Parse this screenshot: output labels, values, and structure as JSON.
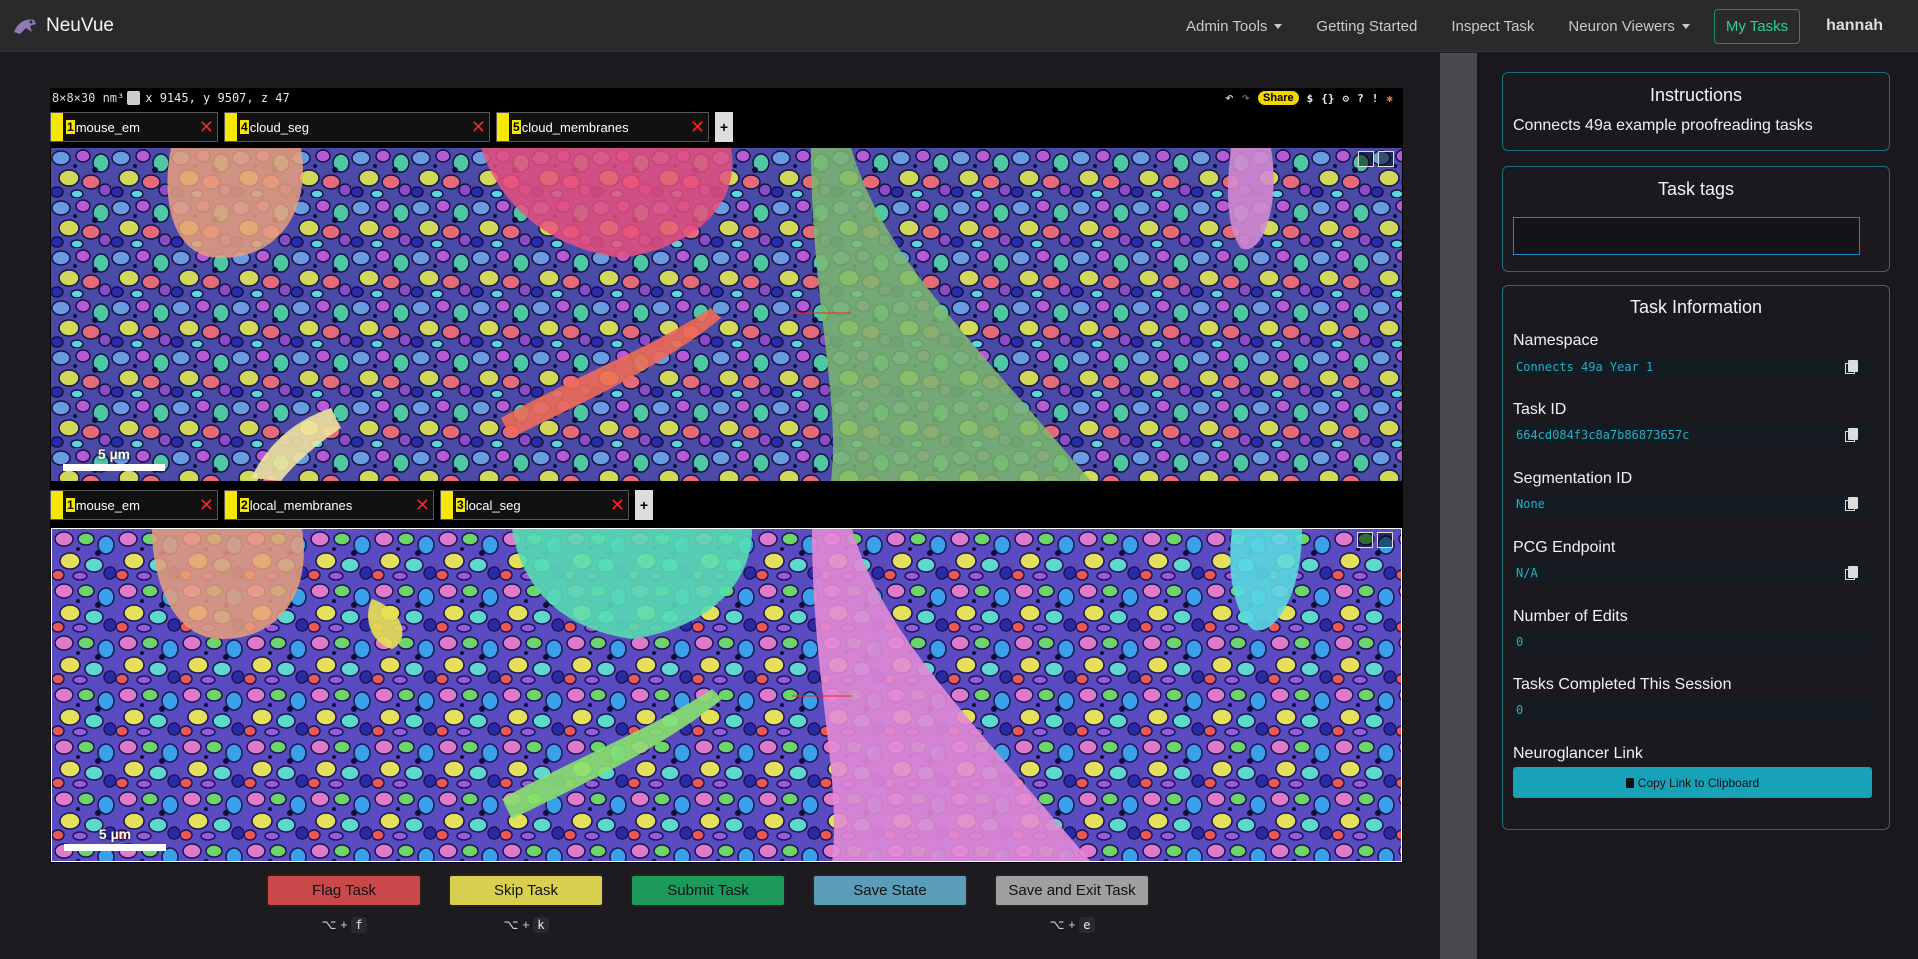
{
  "navbar": {
    "brand": "NeuVue",
    "items": [
      {
        "label": "Admin Tools",
        "dropdown": true
      },
      {
        "label": "Getting Started",
        "dropdown": false
      },
      {
        "label": "Inspect Task",
        "dropdown": false
      },
      {
        "label": "Neuron Viewers",
        "dropdown": true
      }
    ],
    "my_tasks": "My Tasks",
    "user": "hannah"
  },
  "viewer": {
    "resolution": "8×8×30 nm³",
    "coords": "x  9145, y 9507, z 47",
    "share_label": "Share",
    "tool_icons": [
      "undo-icon",
      "redo-icon",
      "dollar-icon",
      "braces-icon",
      "settings-icon",
      "help-icon",
      "alert-icon",
      "bug-icon"
    ],
    "top_layers": [
      {
        "num": "1",
        "name": "mouse_em"
      },
      {
        "num": "4",
        "name": "cloud_seg"
      },
      {
        "num": "5",
        "name": "cloud_membranes"
      }
    ],
    "bottom_layers": [
      {
        "num": "1",
        "name": "mouse_em"
      },
      {
        "num": "2",
        "name": "local_membranes"
      },
      {
        "num": "3",
        "name": "local_seg"
      }
    ],
    "add_layer_label": "+",
    "scale_label": "5 µm"
  },
  "actions": [
    {
      "label": "Flag Task",
      "color": "#c9484a",
      "shortcut_key": "f"
    },
    {
      "label": "Skip Task",
      "color": "#d8cf50",
      "shortcut_key": "k"
    },
    {
      "label": "Submit Task",
      "color": "#1b9a5c",
      "shortcut_key": ""
    },
    {
      "label": "Save State",
      "color": "#5b9db8",
      "shortcut_key": ""
    },
    {
      "label": "Save and Exit Task",
      "color": "#a09e9e",
      "shortcut_key": "e"
    }
  ],
  "shortcut_prefix": "⌥ + ",
  "instructions": {
    "title": "Instructions",
    "text": "Connects 49a example proofreading tasks"
  },
  "task_tags": {
    "title": "Task tags",
    "value": ""
  },
  "task_info": {
    "title": "Task Information",
    "fields": [
      {
        "label": "Namespace",
        "value": "Connects 49a Year 1",
        "copy": true
      },
      {
        "label": "Task ID",
        "value": "664cd084f3c8a7b86873657c",
        "copy": true
      },
      {
        "label": "Segmentation ID",
        "value": "None",
        "copy": true
      },
      {
        "label": "PCG Endpoint",
        "value": "N/A",
        "copy": true
      },
      {
        "label": "Number of Edits",
        "value": "0",
        "copy": false
      },
      {
        "label": "Tasks Completed This Session",
        "value": "0",
        "copy": false
      }
    ],
    "link_label": "Neuroglancer Link",
    "link_button": "Copy Link to Clipboard"
  }
}
